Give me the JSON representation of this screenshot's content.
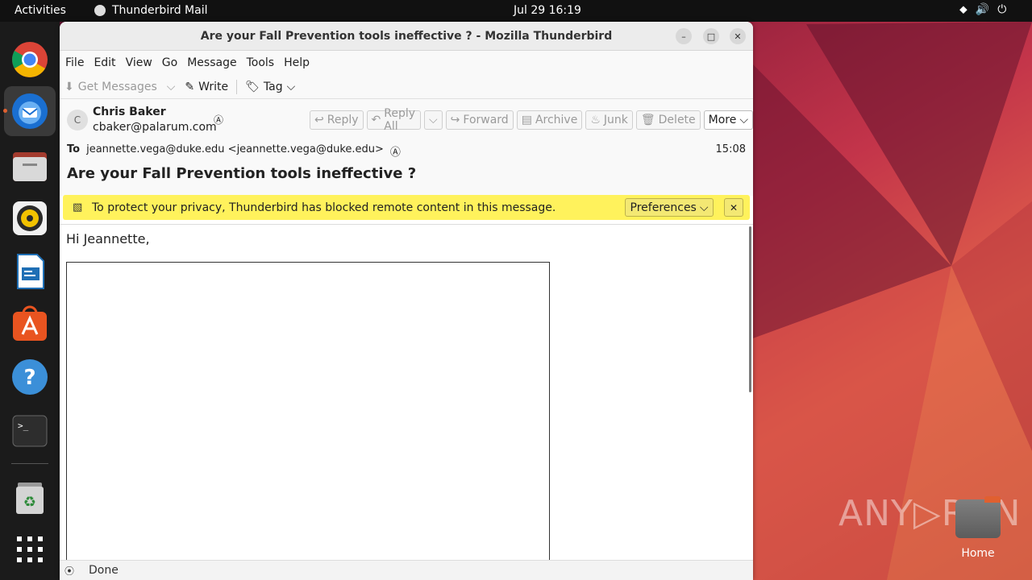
{
  "topbar": {
    "activities": "Activities",
    "app_name": "Thunderbird Mail",
    "clock": "Jul 29  16:19"
  },
  "dock": {
    "items": [
      "chrome-icon",
      "thunderbird-icon",
      "files-icon",
      "rhythmbox-icon",
      "writer-icon",
      "app-center-icon",
      "help-icon",
      "terminal-icon",
      "trash-icon",
      "show-apps-icon"
    ]
  },
  "window": {
    "title": "Are your Fall Prevention tools ineffective ? - Mozilla Thunderbird"
  },
  "menu": {
    "file": "File",
    "edit": "Edit",
    "view": "View",
    "go": "Go",
    "message": "Message",
    "tools": "Tools",
    "help": "Help"
  },
  "toolbar": {
    "get_messages": "Get Messages",
    "write": "Write",
    "tag": "Tag"
  },
  "message": {
    "avatar_letter": "C",
    "from_name": "Chris Baker",
    "from_email": "cbaker@palarum.com",
    "to_label": "To",
    "to_value": "jeannette.vega@duke.edu <jeannette.vega@duke.edu>",
    "time": "15:08",
    "subject": "Are your Fall Prevention tools ineffective ?",
    "actions": {
      "reply": "Reply",
      "reply_all": "Reply All",
      "forward": "Forward",
      "archive": "Archive",
      "junk": "Junk",
      "delete": "Delete",
      "more": "More"
    },
    "greeting": "Hi Jeannette,"
  },
  "notice": {
    "text": "To protect your privacy, Thunderbird has blocked remote content in this message.",
    "preferences": "Preferences"
  },
  "status": {
    "text": "Done"
  },
  "desktop": {
    "home_label": "Home",
    "watermark": "ANY RUN"
  }
}
